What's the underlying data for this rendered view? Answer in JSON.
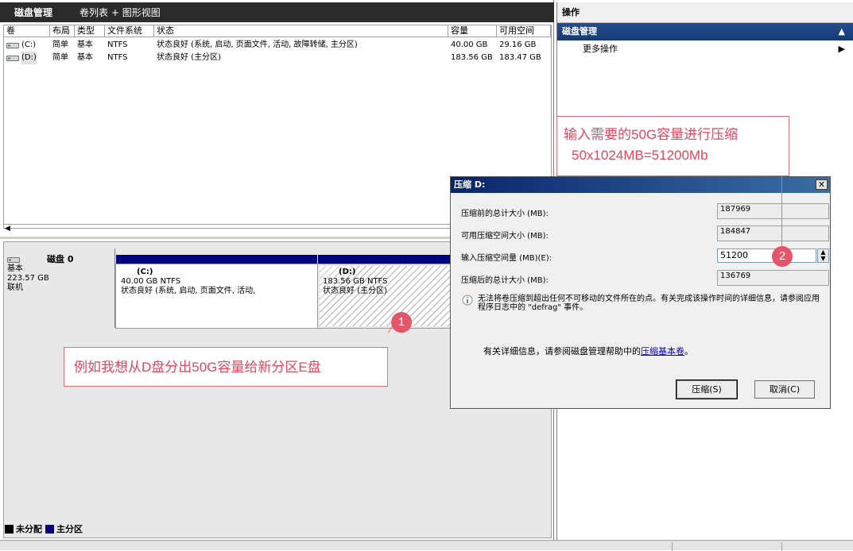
{
  "view_header": {
    "title": "磁盘管理",
    "view": "卷列表 + 图形视图"
  },
  "volume_list": {
    "columns": [
      "卷",
      "布局",
      "类型",
      "文件系统",
      "状态",
      "容量",
      "可用空间"
    ],
    "rows": [
      {
        "volume": "(C:)",
        "layout": "简单",
        "type": "基本",
        "fs": "NTFS",
        "status": "状态良好 (系统, 启动, 页面文件, 活动, 故障转储, 主分区)",
        "capacity": "40.00 GB",
        "free": "29.16 GB"
      },
      {
        "volume": "(D:)",
        "layout": "简单",
        "type": "基本",
        "fs": "NTFS",
        "status": "状态良好 (主分区)",
        "capacity": "183.56 GB",
        "free": "183.47 GB"
      }
    ]
  },
  "disk": {
    "name": "磁盘 0",
    "type": "基本",
    "size": "223.57 GB",
    "state": "联机",
    "partitions": [
      {
        "name": "(C:)",
        "size_fs": "40.00 GB NTFS",
        "status": "状态良好 (系统, 启动, 页面文件, 活动,"
      },
      {
        "name": "(D:)",
        "size_fs": "183.56 GB NTFS",
        "status": "状态良好 (主分区)"
      }
    ]
  },
  "legend": {
    "unallocated": "未分配",
    "primary": "主分区"
  },
  "actions": {
    "header": "操作",
    "section": "磁盘管理",
    "more": "更多操作"
  },
  "dialog": {
    "title": "压缩 D:",
    "fields": [
      {
        "label": "压缩前的总计大小 (MB):",
        "value": "187969"
      },
      {
        "label": "可用压缩空间大小 (MB):",
        "value": "184847"
      },
      {
        "label": "输入压缩空间量 (MB)(E):",
        "value": "51200"
      },
      {
        "label": "压缩后的总计大小 (MB):",
        "value": "136769"
      }
    ],
    "info": "无法将卷压缩到超出任何不可移动的文件所在的点。有关完成该操作时间的详细信息，请参阅应用程序日志中的 \"defrag\" 事件。",
    "more_prefix": "有关详细信息，请参阅磁盘管理帮助中的",
    "more_link": "压缩基本卷",
    "more_suffix": "。",
    "ok": "压缩(S)",
    "cancel": "取消(C)"
  },
  "annotations": {
    "note1": "例如我想从D盘分出50G容量给新分区E盘",
    "note2_line1": "输入需要的50G容量进行压缩",
    "note2_line2": "50x1024MB=51200Mb",
    "badge1": "1",
    "badge2": "2"
  },
  "colors": {
    "primary_partition": "#000080",
    "annotation": "#e5465c",
    "header_dark": "#2b2b2b"
  }
}
